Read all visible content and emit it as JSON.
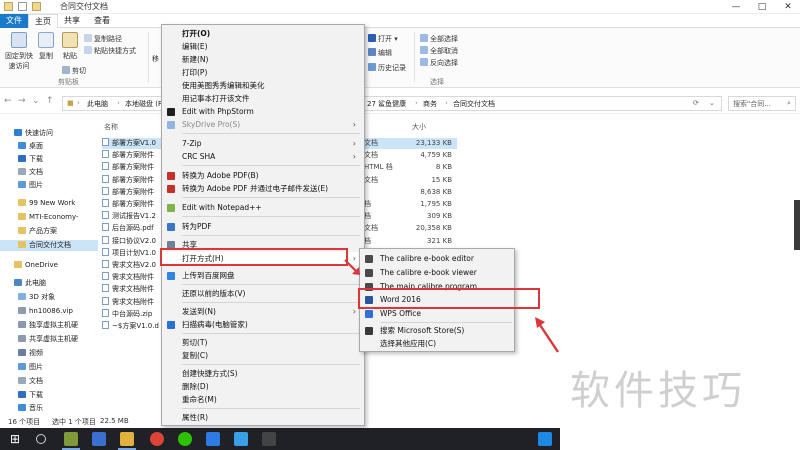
{
  "window": {
    "title": "合同交付文档",
    "controls": [
      "—",
      "□",
      "✕"
    ]
  },
  "menubar": {
    "tabs": [
      "文件",
      "主页",
      "共享",
      "查看"
    ]
  },
  "ribbon": {
    "pin_label": "固定到快\n速访问",
    "copy_label": "复制",
    "paste_label": "粘贴",
    "copy_path_label": "复制路径",
    "paste_shortcut_label": "粘贴快捷方式",
    "cut_label": "剪切",
    "move_label": "移",
    "clipboard_group": "剪贴板",
    "open_label": "打开",
    "edit_label": "编辑",
    "history_label": "历史记录",
    "select_all_label": "全部选择",
    "select_none_label": "全部取消",
    "invert_label": "反向选择",
    "select_group": "选择"
  },
  "address": {
    "crumbs": [
      "此电脑",
      "本地磁盘 (F:",
      "27 鲨鱼健康",
      "商务",
      "合同交付文档"
    ],
    "search_placeholder": "搜索\"合同..."
  },
  "sidebar": {
    "items": [
      "快速访问",
      "桌面",
      "下载",
      "文档",
      "图片",
      "99 New Work",
      "MTI-Economy-",
      "产品方案",
      "合同交付文档",
      "OneDrive",
      "此电脑",
      "3D 对象",
      "hn10086.vip",
      "独享虚拟主机硬",
      "共享虚拟主机硬",
      "视频",
      "图片",
      "文档",
      "下载",
      "音乐"
    ]
  },
  "filelist": {
    "name_header": "名称",
    "size_header": "大小",
    "rows": [
      {
        "name": "部署方案V1.0",
        "type": "文档",
        "size": "23,133 KB"
      },
      {
        "name": "部署方案附件",
        "type": "文档",
        "size": "4,759 KB"
      },
      {
        "name": "部署方案附件",
        "type": "HTML 档",
        "size": "8 KB"
      },
      {
        "name": "部署方案附件",
        "type": "文档",
        "size": "15 KB"
      },
      {
        "name": "部署方案附件",
        "type": "",
        "size": "8,638 KB"
      },
      {
        "name": "部署方案附件",
        "type": "档",
        "size": "1,795 KB"
      },
      {
        "name": "测试报告V1.2",
        "type": "档",
        "size": "309 KB"
      },
      {
        "name": "后台源码.pdf",
        "type": "文档",
        "size": "20,358 KB"
      },
      {
        "name": "接口协议V2.0",
        "type": "档",
        "size": "321 KB"
      },
      {
        "name": "项目计划V1.0",
        "type": "",
        "size": ""
      },
      {
        "name": "需求文档V2.0",
        "type": "",
        "size": ""
      },
      {
        "name": "需求文档附件",
        "type": "",
        "size": ""
      },
      {
        "name": "需求文档附件",
        "type": "",
        "size": ""
      },
      {
        "name": "需求文档附件",
        "type": "",
        "size": ""
      },
      {
        "name": "中台源码.zip",
        "type": "",
        "size": ""
      },
      {
        "name": "~$方案V1.0.d",
        "type": "",
        "size": ""
      }
    ]
  },
  "status": {
    "count": "16 个项目",
    "selected": "选中 1 个项目",
    "size": "22.5 MB"
  },
  "context_menu": {
    "items": [
      {
        "label": "打开(O)",
        "bold": true
      },
      {
        "label": "编辑(E)"
      },
      {
        "label": "新建(N)"
      },
      {
        "label": "打印(P)"
      },
      {
        "label": "使用美图秀秀编辑和美化"
      },
      {
        "label": "用记事本打开该文件"
      },
      {
        "label": "Edit with PhpStorm"
      },
      {
        "label": "SkyDrive Pro(S)",
        "disabled": true
      },
      {
        "label": "7-Zip"
      },
      {
        "label": "CRC SHA"
      },
      {
        "label": "转换为 Adobe PDF(B)"
      },
      {
        "label": "转换为 Adobe PDF 并通过电子邮件发送(E)"
      },
      {
        "label": "Edit with Notepad++"
      },
      {
        "label": "转为PDF"
      },
      {
        "label": "共享"
      },
      {
        "label": "打开方式(H)"
      },
      {
        "label": "上传到百度网盘"
      },
      {
        "label": "还原以前的版本(V)"
      },
      {
        "label": "发送到(N)"
      },
      {
        "label": "扫描病毒(电脑管家)"
      },
      {
        "label": "剪切(T)"
      },
      {
        "label": "复制(C)"
      },
      {
        "label": "创建快捷方式(S)"
      },
      {
        "label": "删除(D)"
      },
      {
        "label": "重命名(M)"
      },
      {
        "label": "属性(R)"
      }
    ]
  },
  "open_with_menu": {
    "items": [
      "The calibre e-book editor",
      "The calibre e-book viewer",
      "The main calibre program",
      "Word 2016",
      "WPS Office",
      "搜索 Microsoft Store(S)",
      "选择其他应用(C)"
    ]
  },
  "watermark": "软件技巧",
  "colors": {
    "accent": "#1979ca",
    "selection": "#cce4f7",
    "highlight_box": "#d9383a",
    "taskbar": "#1f2127"
  }
}
